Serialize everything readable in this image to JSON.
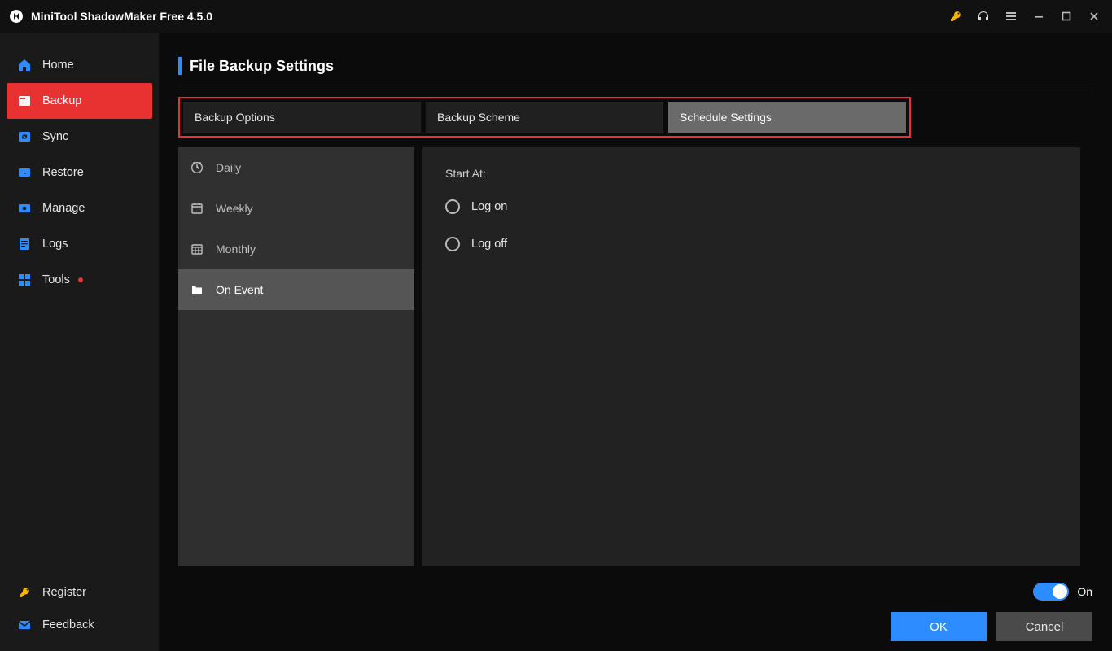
{
  "app": {
    "title": "MiniTool ShadowMaker Free 4.5.0"
  },
  "titlebar_icons": {
    "key": "key-icon",
    "headphones": "headphones-icon",
    "menu": "menu-icon",
    "min": "minimize-icon",
    "max": "maximize-icon",
    "close": "close-icon"
  },
  "sidebar": {
    "items": [
      {
        "label": "Home",
        "icon": "home-icon"
      },
      {
        "label": "Backup",
        "icon": "backup-icon",
        "active": true
      },
      {
        "label": "Sync",
        "icon": "sync-icon"
      },
      {
        "label": "Restore",
        "icon": "restore-icon"
      },
      {
        "label": "Manage",
        "icon": "manage-icon"
      },
      {
        "label": "Logs",
        "icon": "logs-icon"
      },
      {
        "label": "Tools",
        "icon": "tools-icon",
        "dot": true
      }
    ],
    "bottom": [
      {
        "label": "Register",
        "icon": "key-icon"
      },
      {
        "label": "Feedback",
        "icon": "mail-icon"
      }
    ]
  },
  "page": {
    "title": "File Backup Settings"
  },
  "tabs": [
    {
      "label": "Backup Options"
    },
    {
      "label": "Backup Scheme"
    },
    {
      "label": "Schedule Settings",
      "active": true
    }
  ],
  "schedule_modes": [
    {
      "label": "Daily",
      "icon": "clock-icon"
    },
    {
      "label": "Weekly",
      "icon": "calendar-icon"
    },
    {
      "label": "Monthly",
      "icon": "calendar-grid-icon"
    },
    {
      "label": "On Event",
      "icon": "folder-icon",
      "selected": true
    }
  ],
  "event_panel": {
    "heading": "Start At:",
    "options": [
      {
        "label": "Log on"
      },
      {
        "label": "Log off"
      }
    ]
  },
  "footer": {
    "toggle_label": "On",
    "ok_label": "OK",
    "cancel_label": "Cancel"
  }
}
